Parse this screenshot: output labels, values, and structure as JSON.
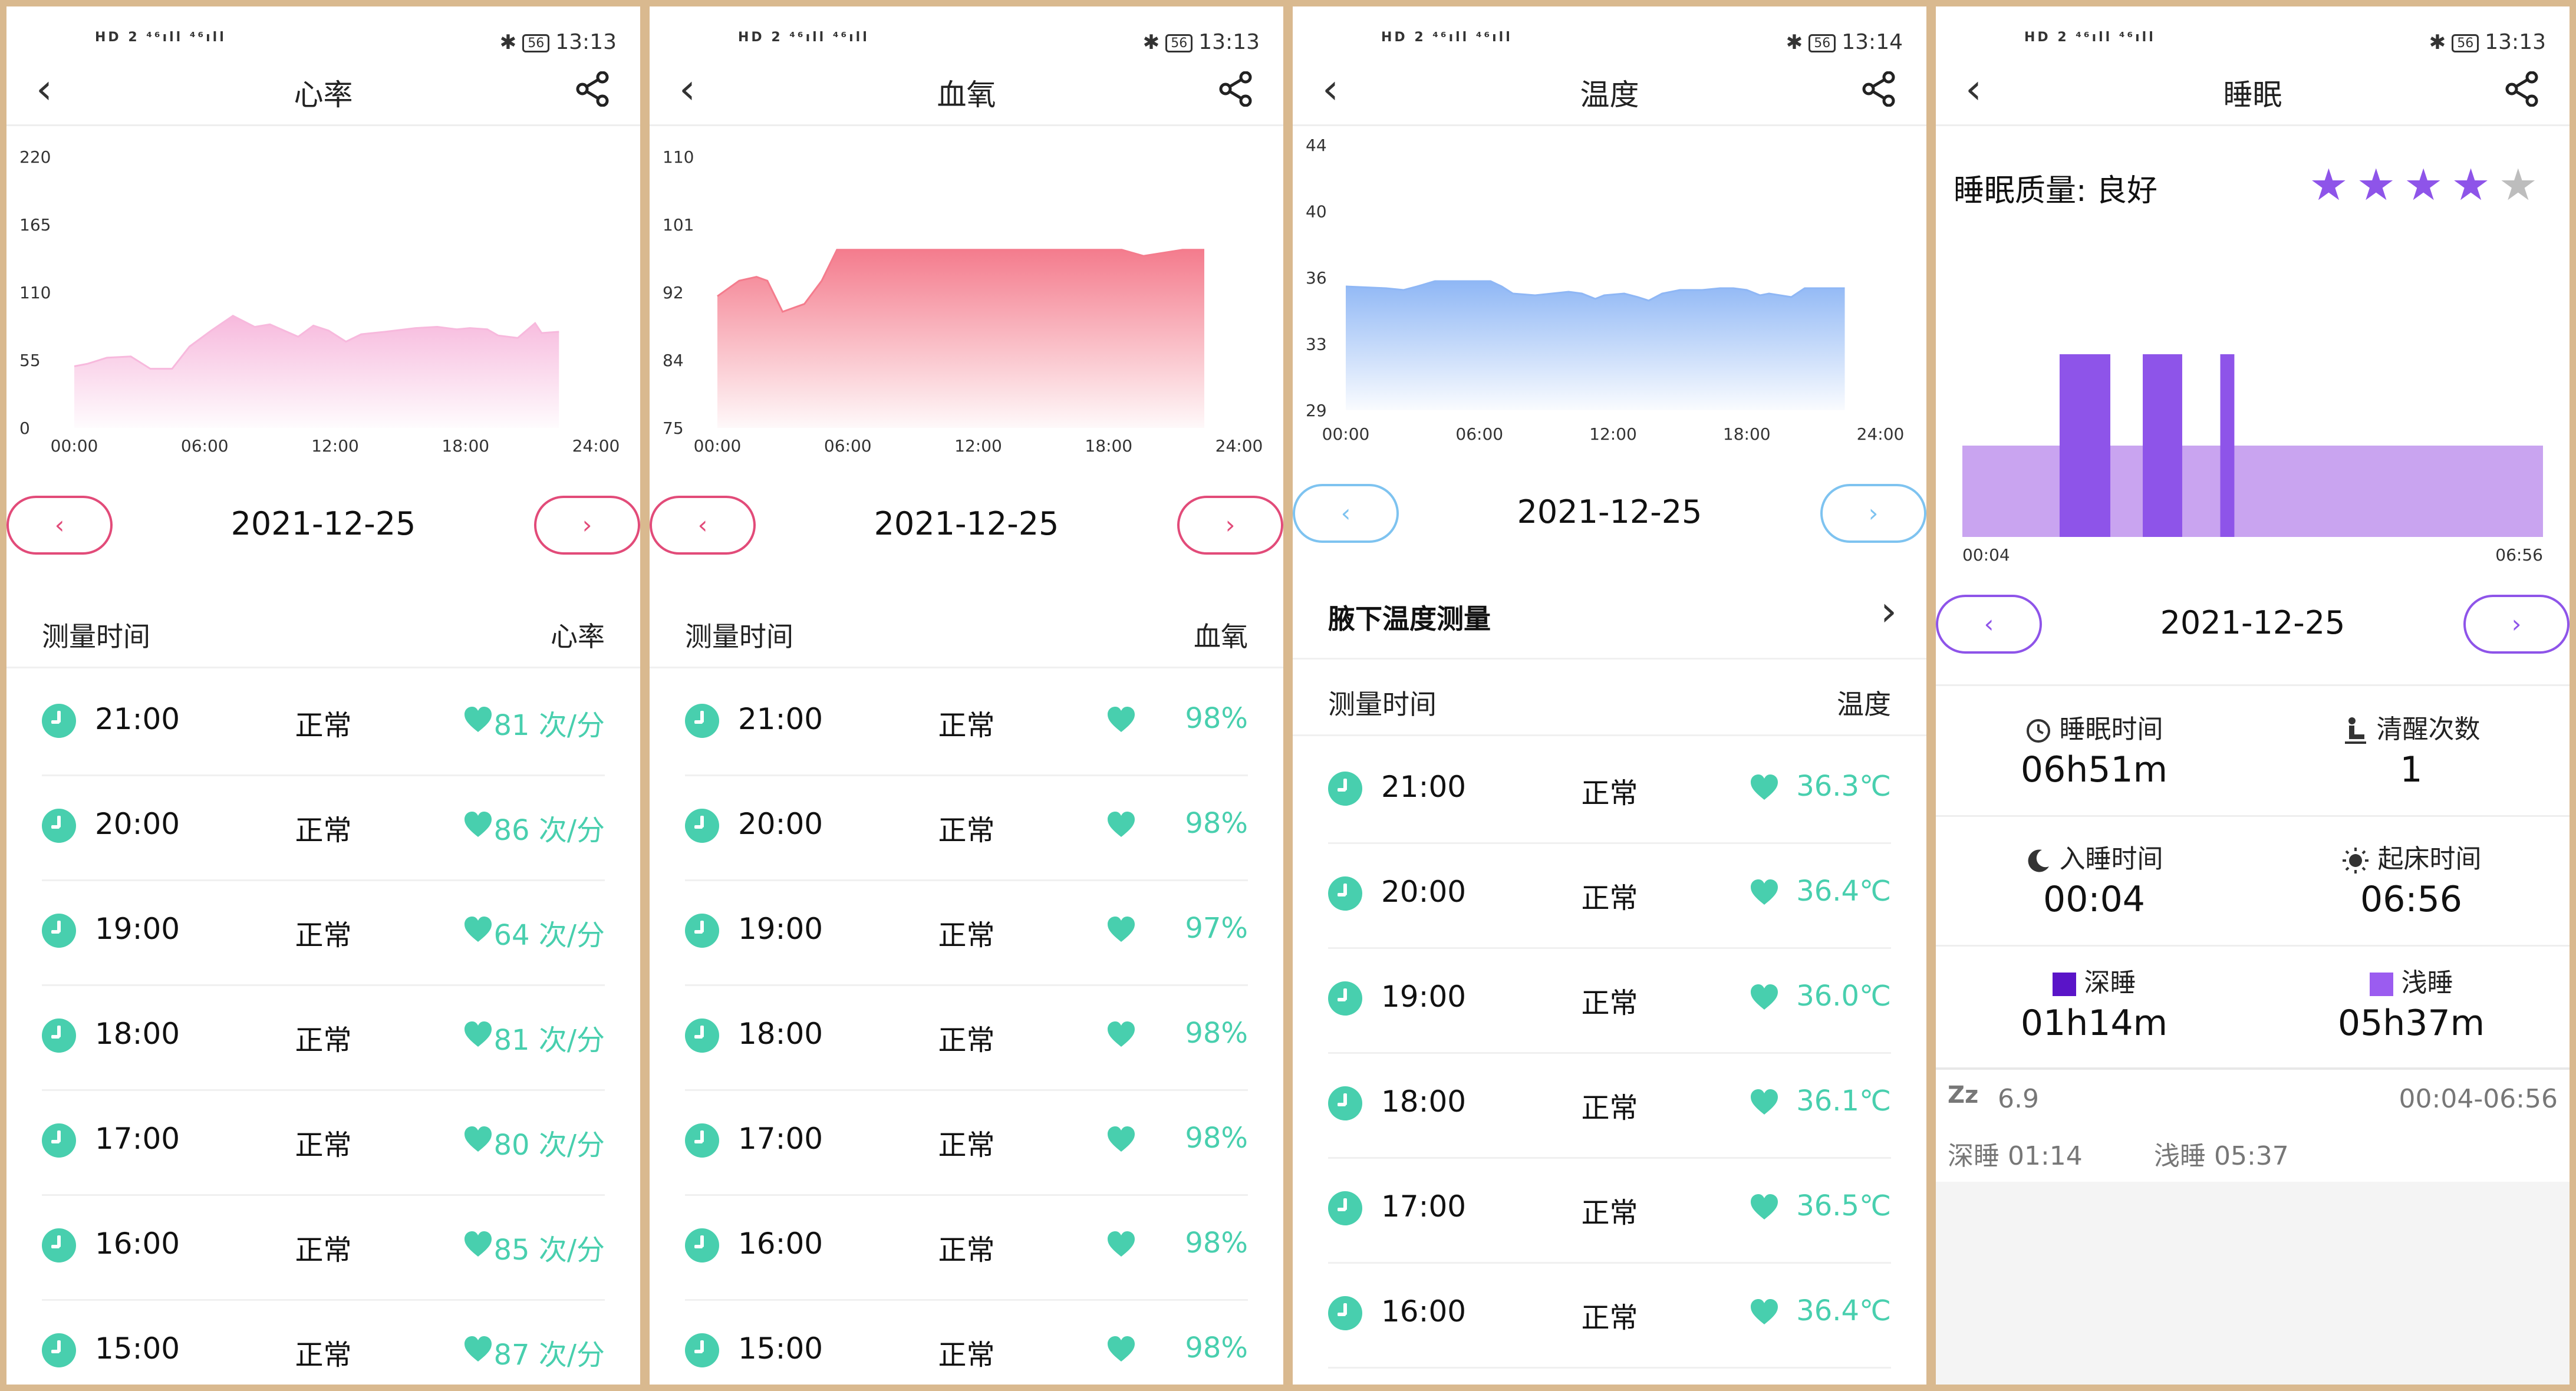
{
  "status": {
    "left": "HD 2 ⁴⁶ıll ⁴⁶ıll",
    "bluetooth": "✱",
    "battery": "56",
    "times": [
      "13:13",
      "13:13",
      "13:14",
      "13:13"
    ]
  },
  "colors": {
    "heart_fill": "#f7b9dd",
    "oxygen_fill": "#f47c8d",
    "temp_fill": "#8fb7f5",
    "value_green": "#48cfae",
    "nav_pink": "#e24b79",
    "nav_blue": "#7ec3f0",
    "nav_purple": "#8e54e9",
    "deep_sleep": "#8e54e9",
    "light_sleep": "#c9a4f0"
  },
  "heart": {
    "title": "心率",
    "date": "2021-12-25",
    "prev": "‹",
    "next": "›",
    "list_header": {
      "left": "测量时间",
      "right": "心率"
    },
    "rows": [
      {
        "time": "21:00",
        "status": "正常",
        "value": "81 次/分"
      },
      {
        "time": "20:00",
        "status": "正常",
        "value": "86 次/分"
      },
      {
        "time": "19:00",
        "status": "正常",
        "value": "64 次/分"
      },
      {
        "time": "18:00",
        "status": "正常",
        "value": "81 次/分"
      },
      {
        "time": "17:00",
        "status": "正常",
        "value": "80 次/分"
      },
      {
        "time": "16:00",
        "status": "正常",
        "value": "85 次/分"
      },
      {
        "time": "15:00",
        "status": "正常",
        "value": "87 次/分"
      }
    ]
  },
  "oxygen": {
    "title": "血氧",
    "date": "2021-12-25",
    "prev": "‹",
    "next": "›",
    "list_header": {
      "left": "测量时间",
      "right": "血氧"
    },
    "rows": [
      {
        "time": "21:00",
        "status": "正常",
        "value": "98%"
      },
      {
        "time": "20:00",
        "status": "正常",
        "value": "98%"
      },
      {
        "time": "19:00",
        "status": "正常",
        "value": "97%"
      },
      {
        "time": "18:00",
        "status": "正常",
        "value": "98%"
      },
      {
        "time": "17:00",
        "status": "正常",
        "value": "98%"
      },
      {
        "time": "16:00",
        "status": "正常",
        "value": "98%"
      },
      {
        "time": "15:00",
        "status": "正常",
        "value": "98%"
      }
    ]
  },
  "temperature": {
    "title": "温度",
    "date": "2021-12-25",
    "prev": "‹",
    "next": "›",
    "section_title": "腋下温度测量",
    "list_header": {
      "left": "测量时间",
      "right": "温度"
    },
    "rows": [
      {
        "time": "21:00",
        "status": "正常",
        "value": "36.3℃"
      },
      {
        "time": "20:00",
        "status": "正常",
        "value": "36.4℃"
      },
      {
        "time": "19:00",
        "status": "正常",
        "value": "36.0℃"
      },
      {
        "time": "18:00",
        "status": "正常",
        "value": "36.1℃"
      },
      {
        "time": "17:00",
        "status": "正常",
        "value": "36.5℃"
      },
      {
        "time": "16:00",
        "status": "正常",
        "value": "36.4℃"
      }
    ]
  },
  "sleep": {
    "title": "睡眠",
    "date": "2021-12-25",
    "prev": "‹",
    "next": "›",
    "quality_label": "睡眠质量:  良好",
    "stars_on": "★★★★",
    "stars_off": "★",
    "stats": {
      "sleep_duration_label": "睡眠时间",
      "sleep_duration": "06h51m",
      "wake_count_label": "清醒次数",
      "wake_count": "1",
      "fall_asleep_label": "入睡时间",
      "fall_asleep": "00:04",
      "wake_up_label": "起床时间",
      "wake_up": "06:56",
      "deep_label": "深睡",
      "deep": "01h14m",
      "light_label": "浅睡",
      "light": "05h37m"
    },
    "summary": {
      "zz": "Zz",
      "score": "6.9",
      "range": "00:04-06:56",
      "deep": "深睡  01:14",
      "light": "浅睡  05:37"
    }
  },
  "chart_data": [
    {
      "type": "area",
      "x_ticks": [
        "00:00",
        "06:00",
        "12:00",
        "18:00",
        "24:00"
      ],
      "y_ticks": [
        "220",
        "165",
        "110",
        "55",
        "0"
      ],
      "ylim": [
        0,
        220
      ],
      "xlim": [
        0,
        24
      ],
      "x": [
        0.0,
        0.6,
        1.5,
        2.6,
        3.5,
        4.5,
        5.3,
        6.3,
        7.3,
        8.3,
        9.0,
        10.3,
        11.0,
        11.7,
        12.5,
        13.2,
        14.3,
        15.7,
        16.7,
        17.6,
        18.2,
        19.0,
        19.5,
        20.4,
        21.2,
        21.5,
        22.3
      ],
      "y": [
        50,
        52,
        57,
        58,
        48,
        48,
        66,
        79,
        91,
        82,
        84,
        74,
        83,
        79,
        70,
        76,
        78,
        81,
        82,
        80,
        81,
        80,
        75,
        73,
        85,
        77,
        78
      ]
    },
    {
      "type": "area",
      "x_ticks": [
        "00:00",
        "06:00",
        "12:00",
        "18:00",
        "24:00"
      ],
      "y_ticks": [
        "110",
        "101",
        "92",
        "84",
        "75"
      ],
      "ylim": [
        75,
        110
      ],
      "xlim": [
        0,
        24
      ],
      "x": [
        0.0,
        1.0,
        1.8,
        2.3,
        3.0,
        4.0,
        4.8,
        5.5,
        18.0,
        18.6,
        19.6,
        21.4,
        22.4
      ],
      "y": [
        92,
        94,
        94.5,
        94,
        90,
        91,
        94,
        98,
        98,
        98,
        97.2,
        98,
        98
      ]
    },
    {
      "type": "area",
      "x_ticks": [
        "00:00",
        "06:00",
        "12:00",
        "18:00",
        "24:00"
      ],
      "y_ticks": [
        "44",
        "40",
        "36",
        "33",
        "29"
      ],
      "ylim": [
        29,
        44
      ],
      "xlim": [
        0,
        24
      ],
      "x": [
        0.0,
        1.8,
        2.6,
        3.2,
        4.0,
        6.5,
        7.0,
        7.5,
        8.5,
        10.0,
        10.6,
        11.2,
        11.6,
        12.5,
        13.1,
        13.6,
        14.2,
        15.0,
        16.0,
        16.8,
        17.4,
        18.0,
        18.6,
        19.0,
        20.0,
        20.6,
        22.4
      ],
      "y": [
        36.0,
        35.9,
        35.8,
        36.0,
        36.3,
        36.3,
        36.0,
        35.6,
        35.5,
        35.7,
        35.6,
        35.3,
        35.5,
        35.6,
        35.4,
        35.2,
        35.6,
        35.8,
        35.8,
        35.9,
        35.9,
        35.8,
        35.5,
        35.6,
        35.4,
        35.9,
        35.9
      ]
    },
    {
      "type": "bar",
      "x_ticks": [
        "00:04",
        "06:56"
      ],
      "start_minutes": 4,
      "end_minutes": 416,
      "light_sleep": [
        {
          "start": 4,
          "end": 416
        }
      ],
      "deep_sleep": [
        {
          "start": 73,
          "end": 109
        },
        {
          "start": 132,
          "end": 160
        },
        {
          "start": 187,
          "end": 197
        }
      ]
    }
  ]
}
